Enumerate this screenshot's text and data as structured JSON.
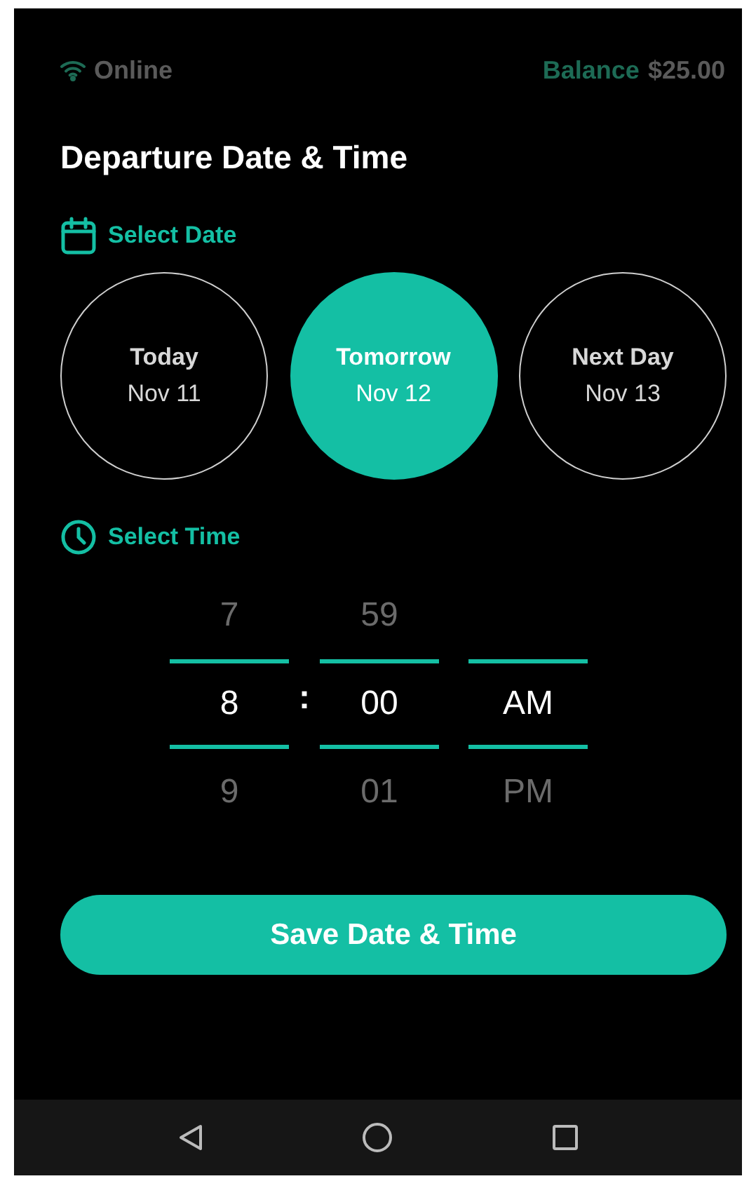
{
  "status_bar": {
    "connection": "Online",
    "balance_label": "Balance",
    "balance_amount": "$25.00"
  },
  "title": "Departure Date & Time",
  "date_section": {
    "label": "Select Date"
  },
  "dates": [
    {
      "day": "Today",
      "date": "Nov 11",
      "selected": false
    },
    {
      "day": "Tomorrow",
      "date": "Nov 12",
      "selected": true
    },
    {
      "day": "Next Day",
      "date": "Nov 13",
      "selected": false
    }
  ],
  "time_section": {
    "label": "Select Time"
  },
  "time_picker": {
    "separator": ":",
    "columns": [
      {
        "above": "7",
        "value": "8",
        "below": "9"
      },
      {
        "above": "59",
        "value": "00",
        "below": "01"
      },
      {
        "value": "AM",
        "below": "PM"
      }
    ]
  },
  "save_button": "Save Date & Time"
}
